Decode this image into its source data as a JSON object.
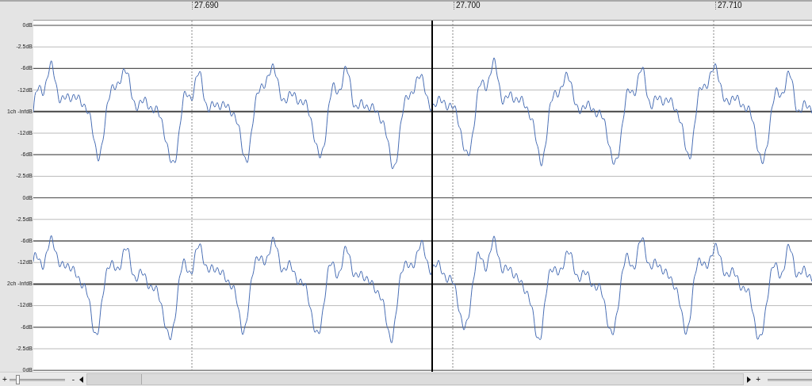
{
  "ruler": {
    "ticks": [
      "27.690",
      "27.700",
      "27.710"
    ]
  },
  "channels": [
    {
      "scale": [
        "0dB",
        "-2.5dB",
        "-6dB",
        "-12dB",
        "1ch -InfdB",
        "-12dB",
        "-6dB",
        "-2.5dB"
      ]
    },
    {
      "scale": [
        "0dB",
        "-2.5dB",
        "-6dB",
        "-12dB",
        "2ch -InfdB",
        "-12dB",
        "-6dB",
        "-2.5dB",
        "0dB"
      ]
    }
  ],
  "bottom_bar": {
    "zoom_in": "+",
    "zoom_out": "-",
    "right_zoom_in": "+"
  }
}
